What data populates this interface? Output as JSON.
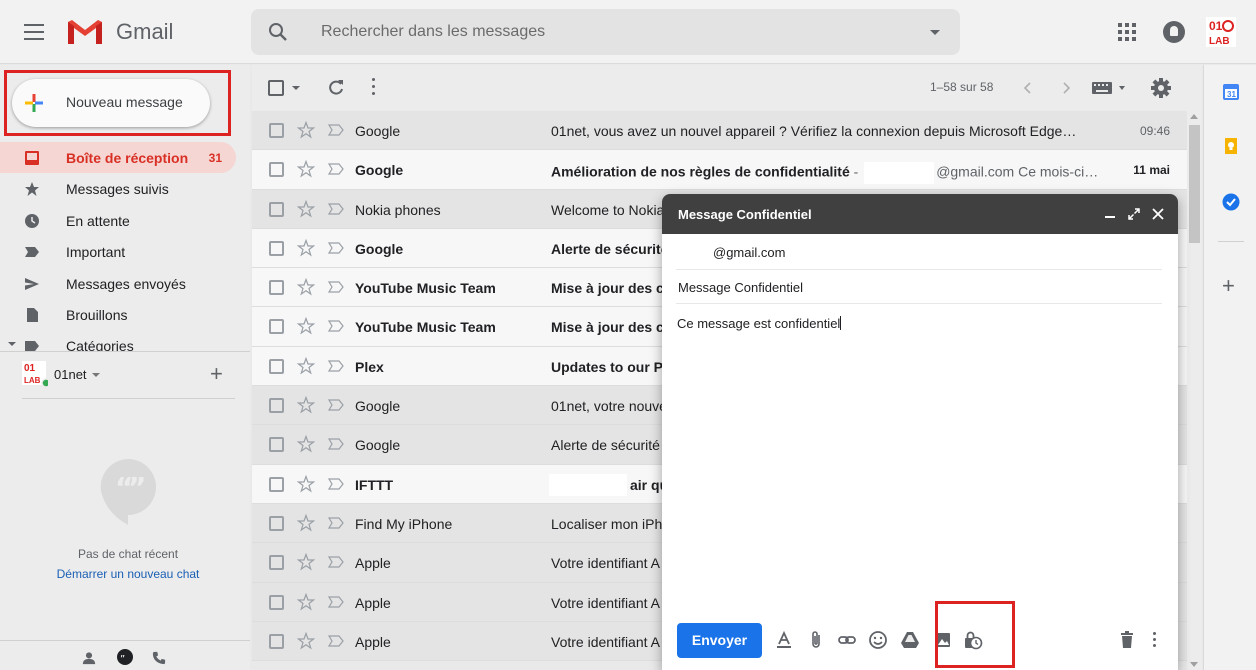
{
  "header": {
    "app_name": "Gmail",
    "search_placeholder": "Rechercher dans les messages"
  },
  "sidebar": {
    "compose_label": "Nouveau message",
    "items": [
      {
        "label": "Boîte de réception",
        "count": "31",
        "icon": "inbox-icon",
        "active": true
      },
      {
        "label": "Messages suivis",
        "count": "",
        "icon": "star-icon"
      },
      {
        "label": "En attente",
        "count": "",
        "icon": "clock-icon"
      },
      {
        "label": "Important",
        "count": "",
        "icon": "important-icon"
      },
      {
        "label": "Messages envoyés",
        "count": "",
        "icon": "send-icon"
      },
      {
        "label": "Brouillons",
        "count": "",
        "icon": "draft-icon"
      },
      {
        "label": "Catégories",
        "count": "",
        "icon": "label-icon"
      }
    ],
    "hangouts_user": "01net",
    "no_chat": "Pas de chat récent",
    "start_chat": "Démarrer un nouveau chat"
  },
  "toolbar": {
    "range": "1–58 sur 58"
  },
  "emails": [
    {
      "sender": "Google",
      "subject": "",
      "preview": "01net, vous avez un nouvel appareil ? Vérifiez la connexion depuis Microsoft Edge…",
      "date": "09:46",
      "unread": false
    },
    {
      "sender": "Google",
      "subject": "Amélioration de nos règles de confidentialité",
      "preview": "@gmail.com Ce mois-ci…",
      "date": "11 mai",
      "unread": true
    },
    {
      "sender": "Nokia phones",
      "subject": "",
      "preview": "Welcome to Nokia",
      "date": "",
      "unread": false
    },
    {
      "sender": "Google",
      "subject": "Alerte de sécurité",
      "preview": "",
      "date": "",
      "unread": false,
      "bold_sender": true
    },
    {
      "sender": "YouTube Music Team",
      "subject": "Mise à jour des cl",
      "preview": "",
      "date": "",
      "unread": false,
      "bold_sender": true
    },
    {
      "sender": "YouTube Music Team",
      "subject": "Mise à jour des cl",
      "preview": "",
      "date": "",
      "unread": false,
      "bold_sender": true
    },
    {
      "sender": "Plex",
      "subject": "Updates to our Pr",
      "preview": "",
      "date": "",
      "unread": false,
      "bold_sender": true
    },
    {
      "sender": "Google",
      "subject": "",
      "preview": "01net, votre nouve",
      "date": "",
      "unread": false
    },
    {
      "sender": "Google",
      "subject": "",
      "preview": "Alerte de sécurité",
      "date": "",
      "unread": false
    },
    {
      "sender": "IFTTT",
      "subject": "air qu",
      "preview": "",
      "date": "",
      "unread": false,
      "bold_sender": true,
      "redacted": true
    },
    {
      "sender": "Find My iPhone",
      "subject": "",
      "preview": "Localiser mon iPh",
      "date": "",
      "unread": false
    },
    {
      "sender": "Apple",
      "subject": "",
      "preview": "Votre identifiant A",
      "date": "",
      "unread": false
    },
    {
      "sender": "Apple",
      "subject": "",
      "preview": "Votre identifiant A",
      "date": "",
      "unread": false
    },
    {
      "sender": "Apple",
      "subject": "",
      "preview": "Votre identifiant A",
      "date": "",
      "unread": false
    }
  ],
  "compose": {
    "title": "Message Confidentiel",
    "to": "@gmail.com",
    "subject": "Message Confidentiel",
    "body": "Ce message est confidentiel",
    "send_label": "Envoyer"
  },
  "colors": {
    "accent_red": "#d93025",
    "send_blue": "#1a73e8",
    "highlight_box": "#dd2222"
  }
}
